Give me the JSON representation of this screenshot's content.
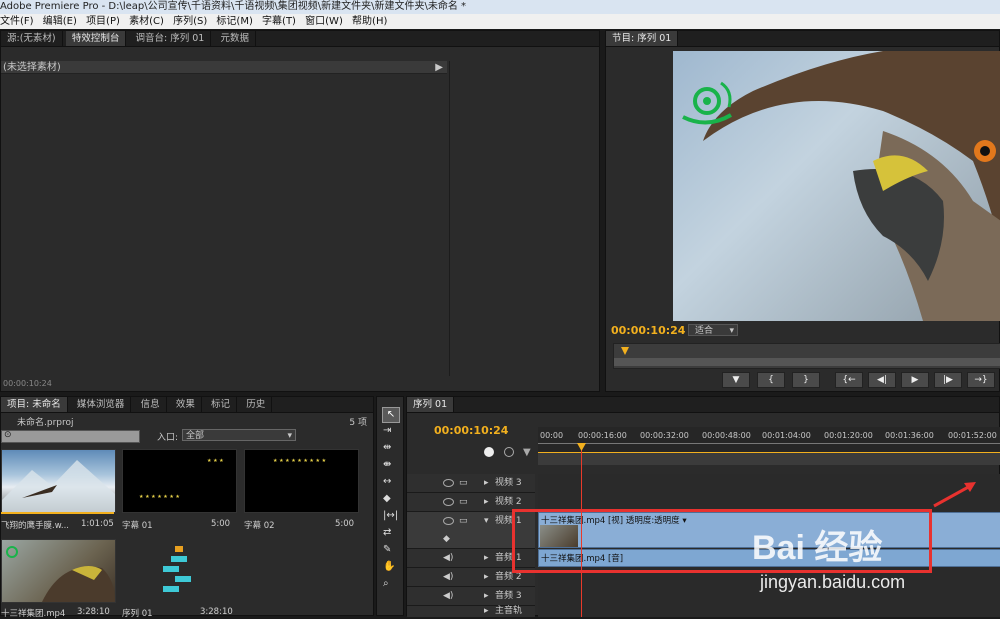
{
  "window": {
    "title": "Adobe Premiere Pro - D:\\leap\\公司宣传\\千语资料\\千语视频\\集团视频\\新建文件夹\\新建文件夹\\未命名 *"
  },
  "menu": [
    "文件(F)",
    "编辑(E)",
    "项目(P)",
    "素材(C)",
    "序列(S)",
    "标记(M)",
    "字幕(T)",
    "窗口(W)",
    "帮助(H)"
  ],
  "source_panel": {
    "tabs": [
      "源:(无素材)",
      "特效控制台",
      "调音台: 序列 01",
      "元数据"
    ],
    "header_text": "(未选择素材)",
    "timecode": "00:00:10:24"
  },
  "program_monitor": {
    "tab": "节目: 序列 01",
    "timecode": "00:00:10:24",
    "fit": "适合",
    "controls": [
      "▼",
      "{",
      "}",
      "{←",
      "◀|",
      "▶",
      "|▶",
      "→}"
    ]
  },
  "project_panel": {
    "tabs": [
      "项目: 未命名",
      "媒体浏览器",
      "信息",
      "效果",
      "标记",
      "历史"
    ],
    "project_file": "未命名.prproj",
    "count": "5 项",
    "inpoint_label": "入口:",
    "inpoint_value": "全部",
    "items": [
      {
        "name": "飞翔的鹰手膜.w...",
        "duration": "1:01:05"
      },
      {
        "name": "字幕 01",
        "duration": "5:00"
      },
      {
        "name": "字幕 02",
        "duration": "5:00"
      },
      {
        "name": "十三祥集团.mp4",
        "duration": "3:28:10"
      },
      {
        "name": "序列 01",
        "duration": "3:28:10"
      }
    ]
  },
  "timeline": {
    "tab": "序列 01",
    "timecode": "00:00:10:24",
    "ruler": [
      "00:00",
      "00:00:16:00",
      "00:00:32:00",
      "00:00:48:00",
      "00:01:04:00",
      "00:01:20:00",
      "00:01:36:00",
      "00:01:52:00"
    ],
    "tracks": [
      "视频 3",
      "视频 2",
      "视频 1",
      "音频 1",
      "音频 2",
      "音频 3",
      "主音轨"
    ],
    "video_clip": "十三祥集团.mp4 [视] 透明度:透明度 ▾",
    "audio_clip": "十三祥集团.mp4 [音]"
  },
  "watermark": {
    "text": "Bai 经验",
    "url": "jingyan.baidu.com"
  },
  "colors": {
    "accent": "#f2b01e",
    "clip_video": "#8aaed6",
    "clip_audio": "#7ea7d2",
    "highlight": "#e8322f"
  }
}
